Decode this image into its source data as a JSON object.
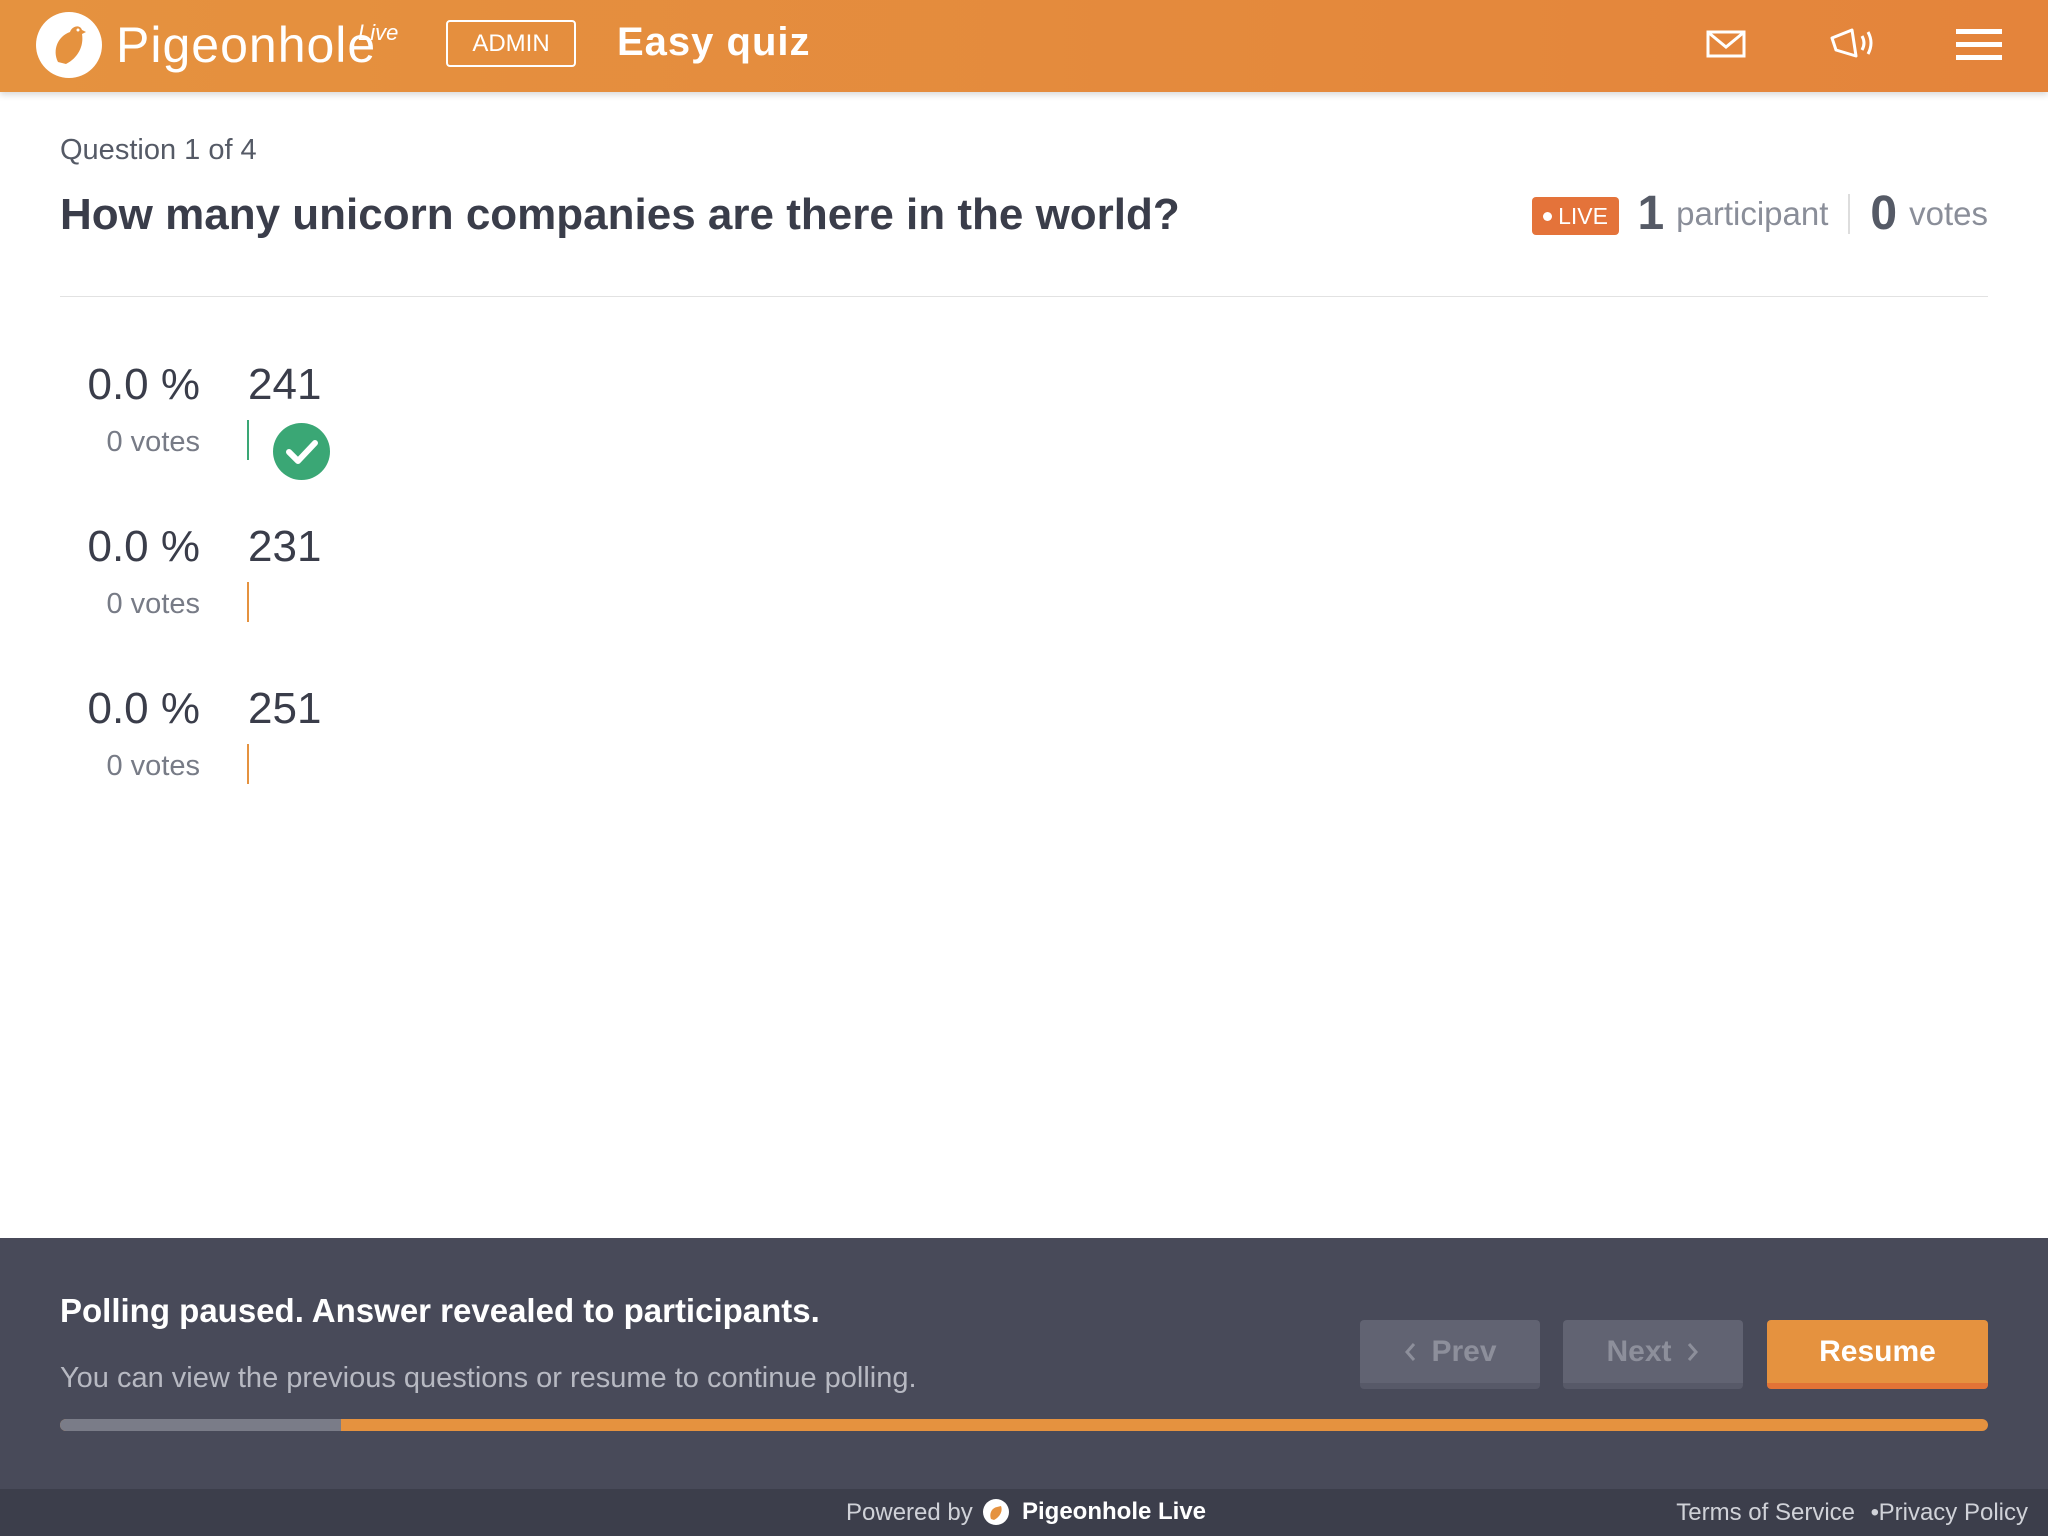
{
  "header": {
    "brand": "Pigeonhole",
    "brand_suffix": "Live",
    "admin_label": "ADMIN",
    "title": "Easy quiz",
    "icons": [
      "mail-icon",
      "megaphone-icon",
      "menu-icon"
    ]
  },
  "question": {
    "counter": "Question 1 of 4",
    "text": "How many unicorn companies are there in the world?",
    "live_label": "LIVE",
    "participants": "1",
    "participants_label": "participant",
    "votes": "0",
    "votes_label": "votes"
  },
  "options": [
    {
      "percent": "0.0 %",
      "votes": "0 votes",
      "answer": "241",
      "correct": true
    },
    {
      "percent": "0.0 %",
      "votes": "0 votes",
      "answer": "231",
      "correct": false
    },
    {
      "percent": "0.0 %",
      "votes": "0 votes",
      "answer": "251",
      "correct": false
    }
  ],
  "panel": {
    "title": "Polling paused. Answer revealed to participants.",
    "subtitle": "You can view the previous questions or resume to continue polling.",
    "prev_label": "Prev",
    "next_label": "Next",
    "resume_label": "Resume",
    "progress_fraction": 0.146
  },
  "footer": {
    "powered_by": "Powered by",
    "brand": "Pigeonhole Live",
    "terms": "Terms of Service",
    "bullet": "•",
    "privacy": "Privacy Policy"
  },
  "colors": {
    "accent": "#e5923f",
    "live": "#e4733a",
    "correct": "#3aa775",
    "panel": "#484a59"
  }
}
